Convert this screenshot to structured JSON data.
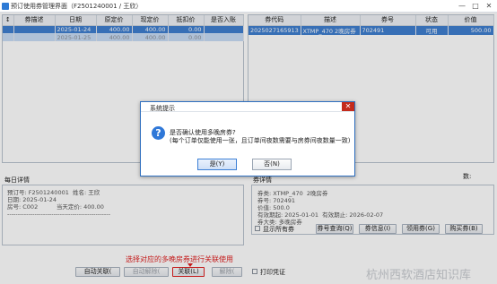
{
  "window": {
    "title": "预订使用券管理界面（F2501240001 / 王欣）",
    "controls": {
      "minimize": "—",
      "maximize": "□",
      "close": "✕"
    }
  },
  "left_table": {
    "headers": [
      "↕",
      "券描述",
      "日期",
      "原定价",
      "现定价",
      "抵扣价",
      "是否入账"
    ],
    "rows": [
      {
        "desc": "",
        "date": "2025-01-24",
        "orig": "400.00",
        "now": "400.00",
        "deduct": "0.00",
        "posted": "",
        "state": "selected"
      },
      {
        "desc": "",
        "date": "2025-01-25",
        "orig": "400.00",
        "now": "400.00",
        "deduct": "0.00",
        "posted": "",
        "state": "secondary"
      }
    ]
  },
  "right_table": {
    "headers": [
      "券代码",
      "描述",
      "券号",
      "状态",
      "价值"
    ],
    "rows": [
      {
        "code": "2025027165913",
        "desc": "XTMP_470  2晚房券",
        "no": "702491",
        "status": "可用",
        "value": "500.00"
      }
    ]
  },
  "daily_detail": {
    "title": "每日详情",
    "lines": "预订号: F2501240001  姓名: 王欣\n日期: 2025-01-24\n房号: C002          当天定价: 400.00\n-------------------------------------------------"
  },
  "coupon_detail": {
    "title": "券详情",
    "lines": "券类: XTMP_470  2晚房券\n券号: 702491\n价值: 500.0\n有效期起: 2025-01-01  有效期止: 2026-02-07\n券大类: 多晚房券",
    "count_label": "数:"
  },
  "bottom": {
    "show_all": "显示所有券",
    "print_voucher": "打印凭证",
    "btn_query": "券号查询(Q)",
    "btn_info": "券信息(I)",
    "btn_use": "领用券(G)",
    "btn_buy": "购买券(B)",
    "btn_auto_link": "自动关联(",
    "btn_auto_unlink": "自动解除(",
    "btn_link": "关联(L)",
    "btn_unlink": "解除(",
    "note": "选择对应的多晚房券进行关联使用"
  },
  "dialog": {
    "title": "系统提示",
    "close": "✕",
    "icon": "?",
    "line1": "是否确认使用多晚房券?",
    "line2": "(每个订单仅能使用一张，且订单间夜数需要与房券间夜数量一致)",
    "yes": "是(Y)",
    "no": "否(N)"
  },
  "watermark": "杭州西软酒店知识库",
  "colors": {
    "selection": "#3f7fd0",
    "accent": "#2f78d8",
    "highlight": "#e02020"
  }
}
